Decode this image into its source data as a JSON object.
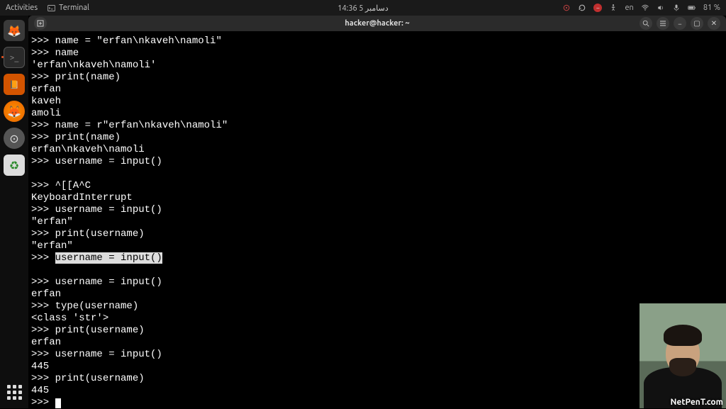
{
  "topbar": {
    "activities": "Activities",
    "app_name": "Terminal",
    "clock": "14:36 5 دسامبر",
    "lang": "en",
    "battery": "81 %"
  },
  "titlebar": {
    "title": "hacker@hacker: ~"
  },
  "terminal": {
    "lines": [
      {
        "t": ">>> name = \"erfan\\nkaveh\\namoli\""
      },
      {
        "t": ">>> name"
      },
      {
        "t": "'erfan\\nkaveh\\namoli'"
      },
      {
        "t": ">>> print(name)"
      },
      {
        "t": "erfan"
      },
      {
        "t": "kaveh"
      },
      {
        "t": "amoli"
      },
      {
        "t": ">>> name = r\"erfan\\nkaveh\\namoli\""
      },
      {
        "t": ">>> print(name)"
      },
      {
        "t": "erfan\\nkaveh\\namoli"
      },
      {
        "t": ">>> username = input()"
      },
      {
        "t": ""
      },
      {
        "t": ">>> ^[[A^C"
      },
      {
        "t": "KeyboardInterrupt"
      },
      {
        "t": ">>> username = input()"
      },
      {
        "t": "\"erfan\""
      },
      {
        "t": ">>> print(username)"
      },
      {
        "t": "\"erfan\""
      },
      {
        "t": ">>> ",
        "hl": "username = input()"
      },
      {
        "t": ""
      },
      {
        "t": ">>> username = input()"
      },
      {
        "t": "erfan"
      },
      {
        "t": ">>> type(username)"
      },
      {
        "t": "<class 'str'>"
      },
      {
        "t": ">>> print(username)"
      },
      {
        "t": "erfan"
      },
      {
        "t": ">>> username = input()"
      },
      {
        "t": "445"
      },
      {
        "t": ">>> print(username)"
      },
      {
        "t": "445"
      },
      {
        "t": ">>> ",
        "cursor": true
      }
    ]
  },
  "camera": {
    "label": "NetPenT.com"
  }
}
